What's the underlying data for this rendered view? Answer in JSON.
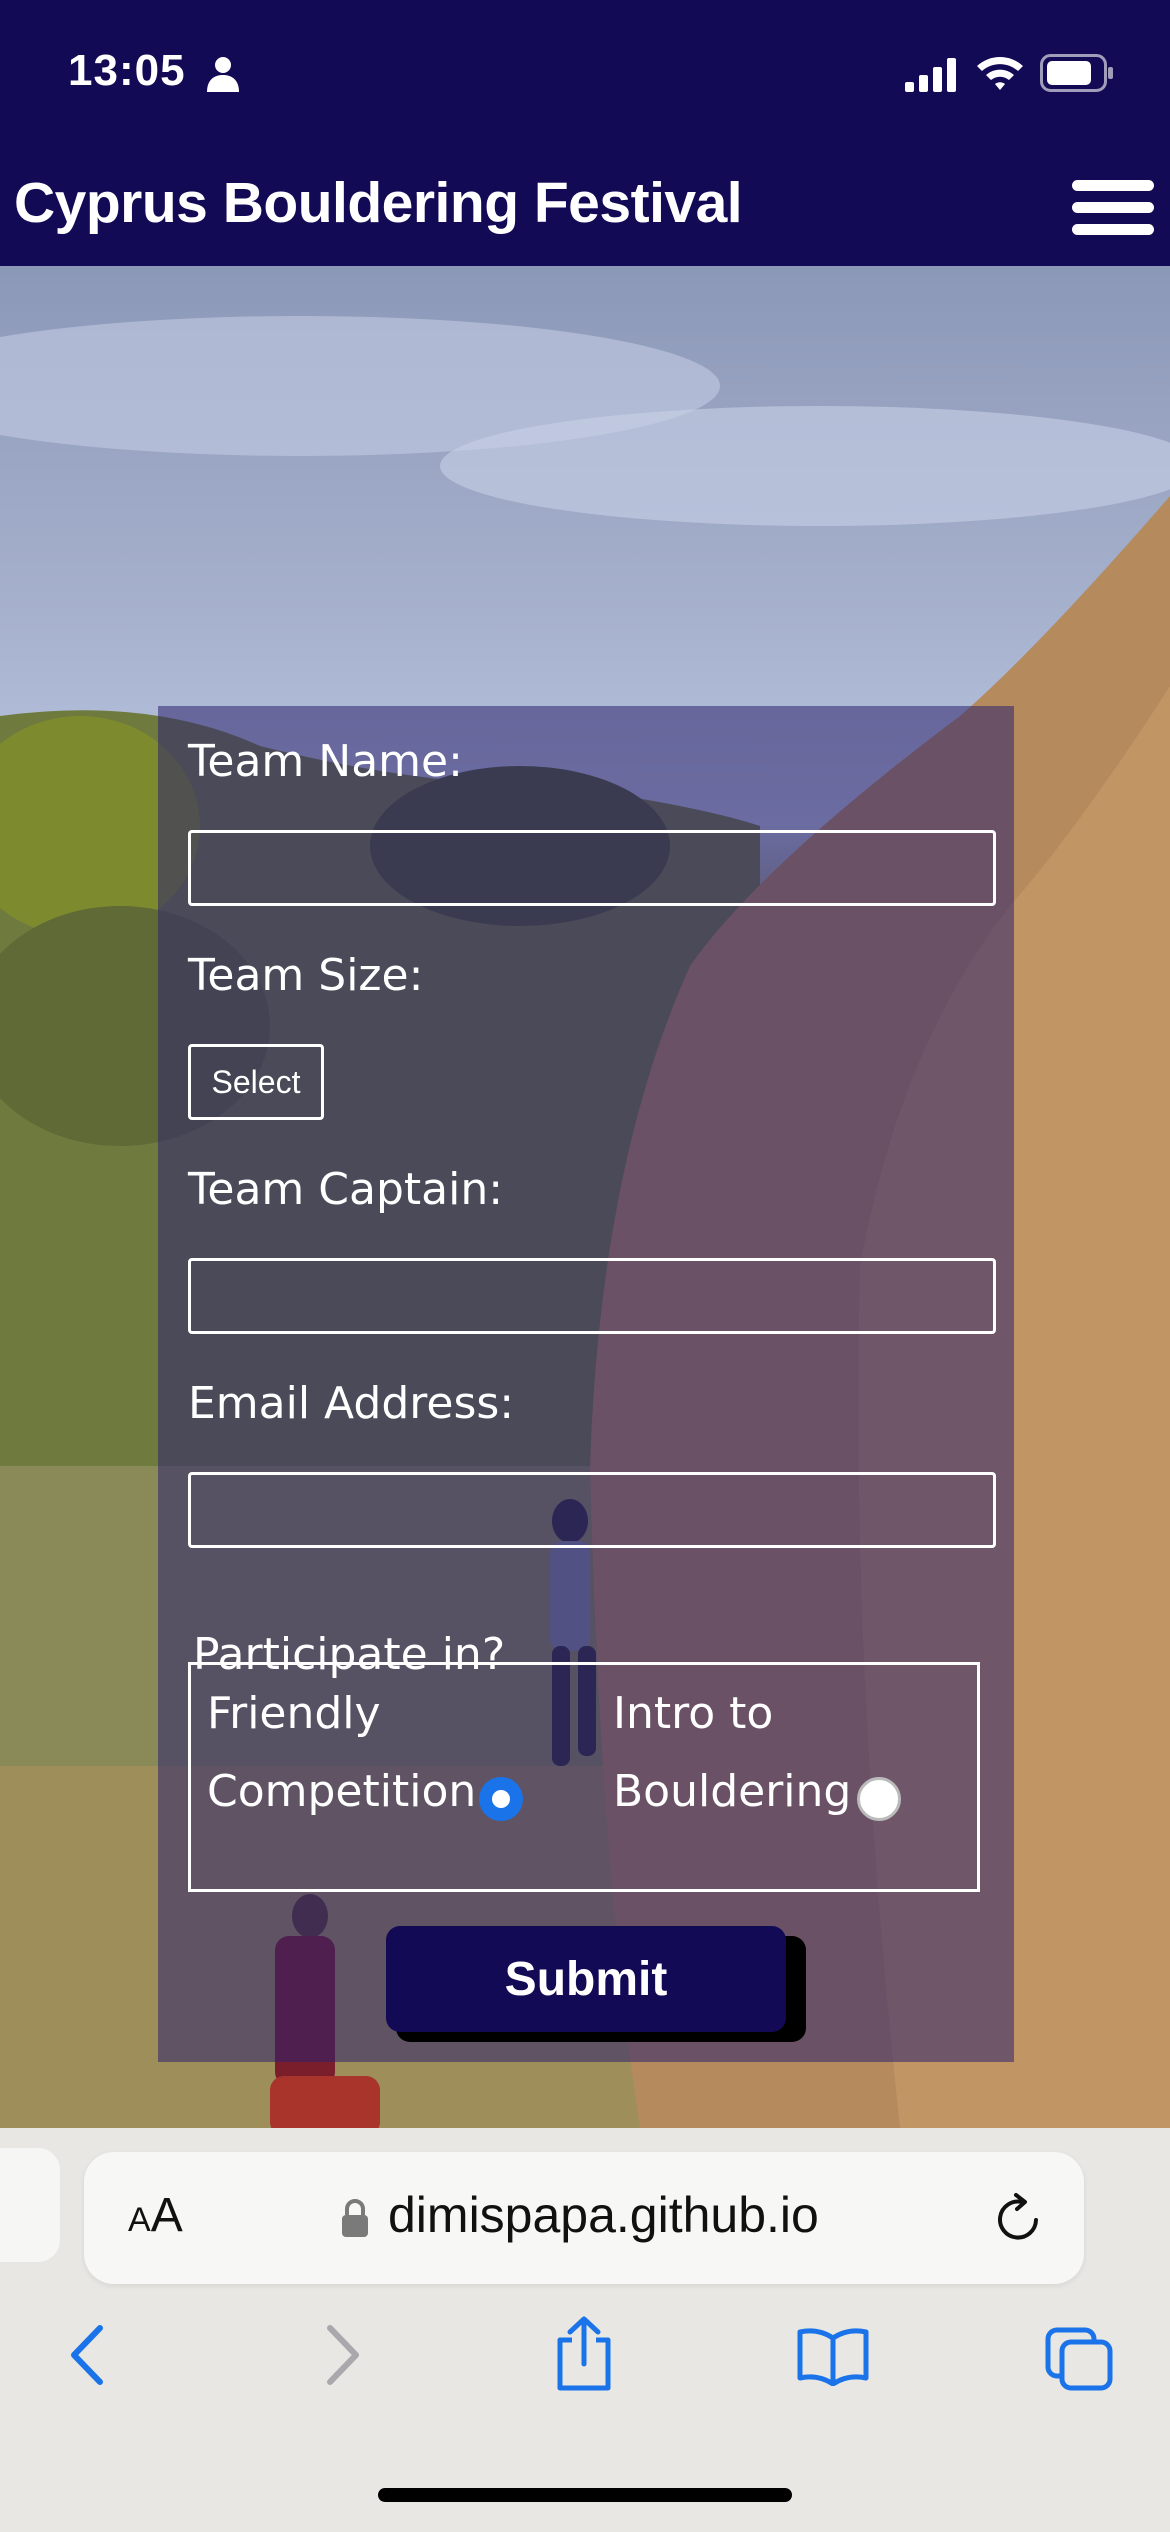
{
  "status_bar": {
    "time": "13:05",
    "icons": [
      "person-icon",
      "signal-icon",
      "wifi-icon",
      "battery-icon"
    ]
  },
  "header": {
    "title": "Cyprus Bouldering Festival",
    "menu_icon": "hamburger-menu-icon"
  },
  "form": {
    "team_name_label": "Team Name:",
    "team_name_value": "",
    "team_size_label": "Team Size:",
    "team_size_selected": "Select",
    "team_captain_label": "Team Captain:",
    "team_captain_value": "",
    "email_label": "Email Address:",
    "email_value": "",
    "participate_legend": "Participate in?",
    "options": [
      {
        "line1": "Friendly",
        "line2": "Competition",
        "checked": true
      },
      {
        "line1": "Intro to",
        "line2": "Bouldering",
        "checked": false
      }
    ],
    "submit_label": "Submit"
  },
  "browser": {
    "text_size_label_small": "A",
    "text_size_label_large": "A",
    "url": "dimispapa.github.io",
    "icons": [
      "lock-icon",
      "reload-icon",
      "back-icon",
      "forward-icon",
      "share-icon",
      "bookmarks-icon",
      "tabs-icon"
    ]
  },
  "colors": {
    "header_bg": "#130a55",
    "form_overlay": "rgba(44,34,110,0.55)",
    "radio_checked": "#1a73e8",
    "toolbar_icon": "#1a73e8"
  }
}
